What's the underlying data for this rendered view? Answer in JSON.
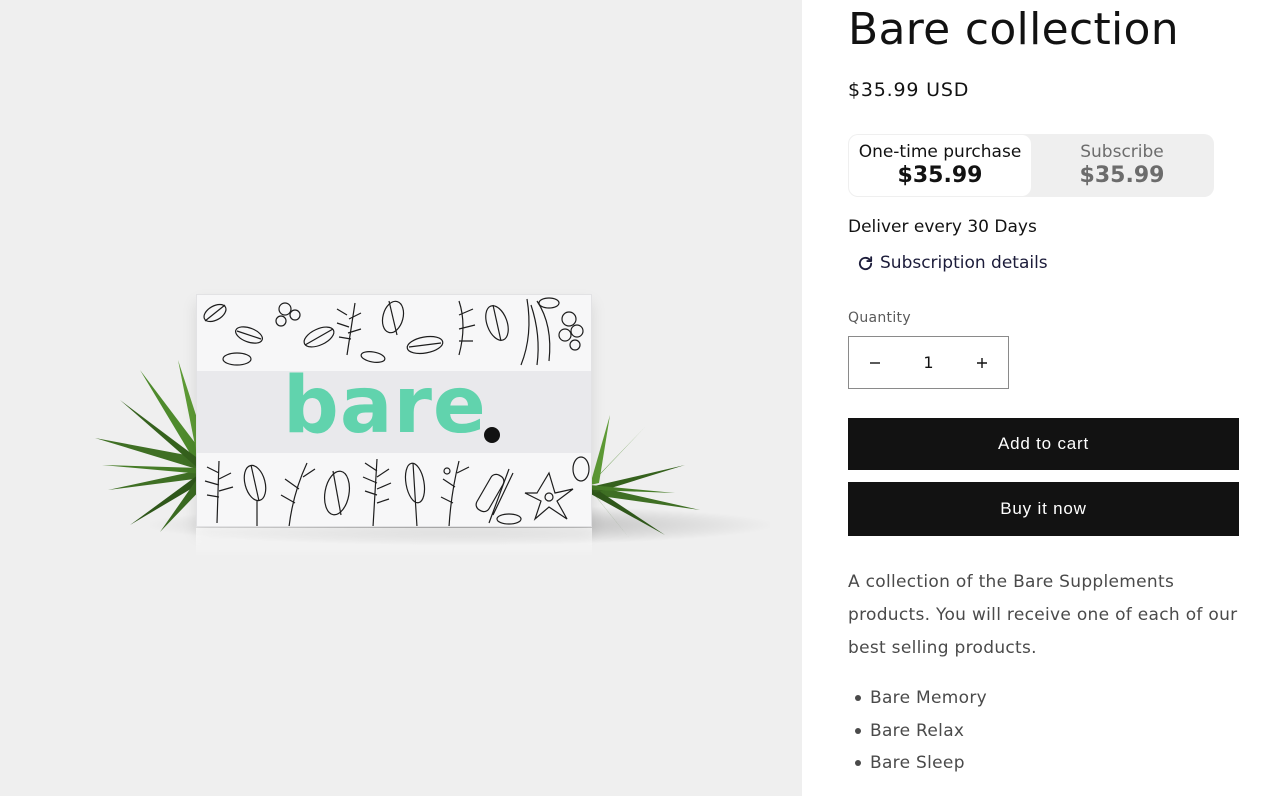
{
  "product": {
    "title": "Bare collection",
    "price": "$35.99 USD",
    "image": {
      "brand_text": "bare",
      "background_color": "#efefef",
      "brand_color": "#61d3ad"
    }
  },
  "purchase_options": [
    {
      "label": "One-time purchase",
      "price": "$35.99",
      "selected": true
    },
    {
      "label": "Subscribe",
      "price": "$35.99",
      "selected": false
    }
  ],
  "subscription": {
    "delivery_text": "Deliver every 30 Days",
    "details_link": "Subscription details",
    "details_icon": "refresh-icon"
  },
  "quantity": {
    "label": "Quantity",
    "value": "1",
    "decrease_icon": "minus-icon",
    "increase_icon": "plus-icon"
  },
  "buttons": {
    "add_to_cart": "Add to cart",
    "buy_now": "Buy it now"
  },
  "description": {
    "text": "A collection of the Bare Supplements products. You will receive one of each of our best selling products.",
    "items": [
      "Bare Memory",
      "Bare Relax",
      "Bare Sleep"
    ]
  },
  "colors": {
    "button_bg": "#121212",
    "button_text": "#ffffff",
    "toggle_bg": "#efefef"
  }
}
